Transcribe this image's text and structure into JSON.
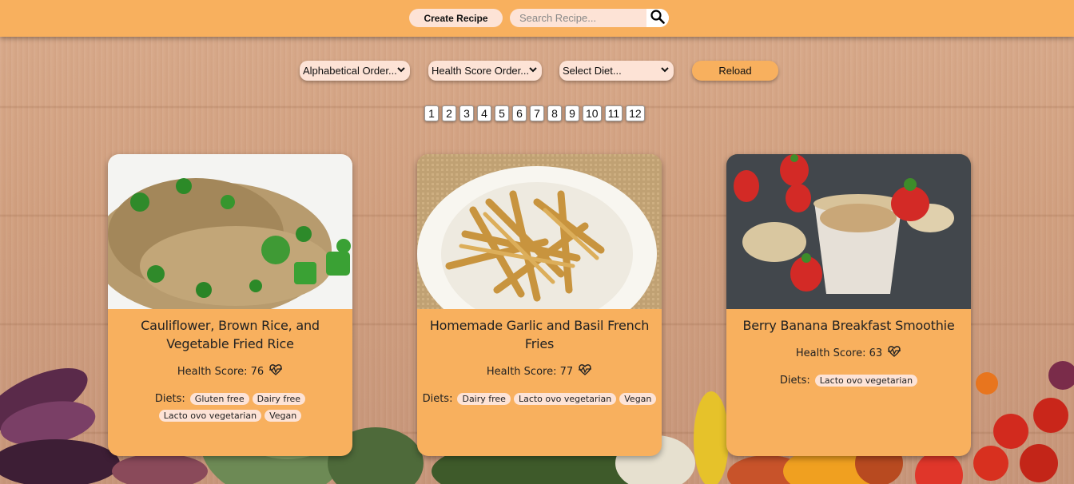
{
  "header": {
    "create_label": "Create Recipe",
    "search_placeholder": "Search Recipe..."
  },
  "controls": {
    "alphabetical_label": "Alphabetical Order...",
    "health_label": "Health Score Order...",
    "diet_label": "Select Diet...",
    "reload_label": "Reload"
  },
  "pagination": [
    "1",
    "2",
    "3",
    "4",
    "5",
    "6",
    "7",
    "8",
    "9",
    "10",
    "11",
    "12"
  ],
  "cards": [
    {
      "title": "Cauliflower, Brown Rice, and Vegetable Fried Rice",
      "health_label": "Health Score: 76",
      "diets_label": "Diets:",
      "diets": [
        "Gluten free",
        "Dairy free",
        "Lacto ovo vegetarian",
        "Vegan"
      ]
    },
    {
      "title": "Homemade Garlic and Basil French Fries",
      "health_label": "Health Score: 77",
      "diets_label": "Diets:",
      "diets": [
        "Dairy free",
        "Lacto ovo vegetarian",
        "Vegan"
      ]
    },
    {
      "title": "Berry Banana Breakfast Smoothie",
      "health_label": "Health Score: 63",
      "diets_label": "Diets:",
      "diets": [
        "Lacto ovo vegetarian"
      ]
    }
  ],
  "colors": {
    "accent": "#f8b05e",
    "chip": "#fde3d6"
  },
  "icons": [
    "search-icon",
    "chevron-down-icon",
    "heartbeat-icon"
  ]
}
